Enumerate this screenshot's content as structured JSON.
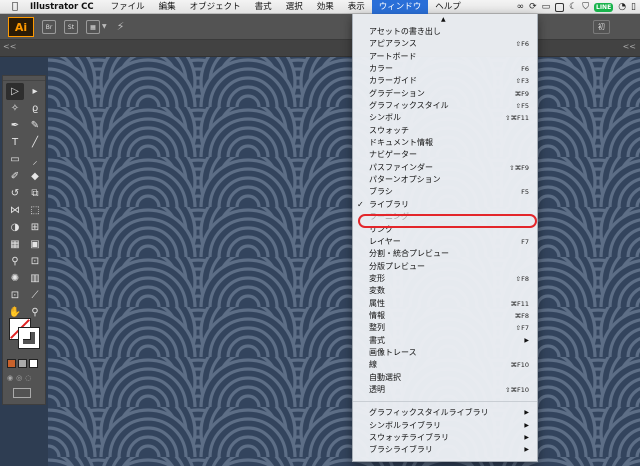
{
  "menubar": {
    "apple": "",
    "app_name": "Illustrator CC",
    "menus": [
      "ファイル",
      "編集",
      "オブジェクト",
      "書式",
      "選択",
      "効果",
      "表示",
      "ウィンドウ",
      "ヘルプ"
    ],
    "active_menu": "ウィンドウ",
    "status_icons": [
      "creative-cloud-icon",
      "sync-icon",
      "display-icon",
      "box-icon",
      "moon-icon",
      "shield-icon",
      "line-icon",
      "wifi-icon",
      "hdmi-icon"
    ]
  },
  "appbar": {
    "logo": "Ai",
    "bridge": "Br",
    "stock": "St",
    "workspace_button": "初"
  },
  "subbar": {
    "collapse_left": "<<",
    "collapse_right": "<<"
  },
  "toolbar": {
    "tools": [
      "selection-tool",
      "direct-selection-tool",
      "magic-wand-tool",
      "lasso-tool",
      "pen-tool",
      "curvature-tool",
      "type-tool",
      "line-tool",
      "rectangle-tool",
      "paintbrush-tool",
      "shaper-tool",
      "eraser-tool",
      "rotate-tool",
      "scale-tool",
      "width-tool",
      "free-transform-tool",
      "shape-builder-tool",
      "perspective-grid-tool",
      "mesh-tool",
      "gradient-tool",
      "eyedropper-tool",
      "blend-tool",
      "symbol-sprayer-tool",
      "column-graph-tool",
      "artboard-tool",
      "slice-tool",
      "hand-tool",
      "zoom-tool"
    ]
  },
  "window_menu": {
    "scroll_indicator": "▲",
    "section1": [
      {
        "label": "アセットの書き出し",
        "shortcut": ""
      },
      {
        "label": "アピアランス",
        "shortcut": "⇧F6"
      },
      {
        "label": "アートボード",
        "shortcut": ""
      },
      {
        "label": "カラー",
        "shortcut": "F6"
      },
      {
        "label": "カラーガイド",
        "shortcut": "⇧F3"
      },
      {
        "label": "グラデーション",
        "shortcut": "⌘F9"
      },
      {
        "label": "グラフィックスタイル",
        "shortcut": "⇧F5"
      },
      {
        "label": "シンボル",
        "shortcut": "⇧⌘F11"
      },
      {
        "label": "スウォッチ",
        "shortcut": ""
      },
      {
        "label": "ドキュメント情報",
        "shortcut": ""
      },
      {
        "label": "ナビゲーター",
        "shortcut": ""
      },
      {
        "label": "パスファインダー",
        "shortcut": "⇧⌘F9"
      },
      {
        "label": "パターンオプション",
        "shortcut": ""
      },
      {
        "label": "ブラシ",
        "shortcut": "F5"
      },
      {
        "label": "ライブラリ",
        "shortcut": "",
        "checked": "✓"
      },
      {
        "label": "ラーニング",
        "shortcut": "",
        "disabled": true
      },
      {
        "label": "リンク",
        "shortcut": ""
      },
      {
        "label": "レイヤー",
        "shortcut": "F7"
      },
      {
        "label": "分割・統合プレビュー",
        "shortcut": ""
      },
      {
        "label": "分版プレビュー",
        "shortcut": ""
      },
      {
        "label": "変形",
        "shortcut": "⇧F8"
      },
      {
        "label": "変数",
        "shortcut": ""
      },
      {
        "label": "属性",
        "shortcut": "⌘F11"
      },
      {
        "label": "情報",
        "shortcut": "⌘F8"
      },
      {
        "label": "整列",
        "shortcut": "⇧F7"
      },
      {
        "label": "書式",
        "shortcut": "",
        "submenu": "▶"
      },
      {
        "label": "画像トレース",
        "shortcut": ""
      },
      {
        "label": "線",
        "shortcut": "⌘F10"
      },
      {
        "label": "自動選択",
        "shortcut": ""
      },
      {
        "label": "透明",
        "shortcut": "⇧⌘F10"
      }
    ],
    "section2": [
      {
        "label": "グラフィックスタイルライブラリ",
        "submenu": "▶"
      },
      {
        "label": "シンボルライブラリ",
        "submenu": "▶"
      },
      {
        "label": "スウォッチライブラリ",
        "submenu": "▶"
      },
      {
        "label": "ブラシライブラリ",
        "submenu": "▶"
      }
    ]
  },
  "colors": {
    "menu_highlight": "#2a6fd8",
    "annotation_ring": "#e3262b",
    "canvas_bg": "#33445d",
    "ai_orange": "#ff9a00"
  }
}
